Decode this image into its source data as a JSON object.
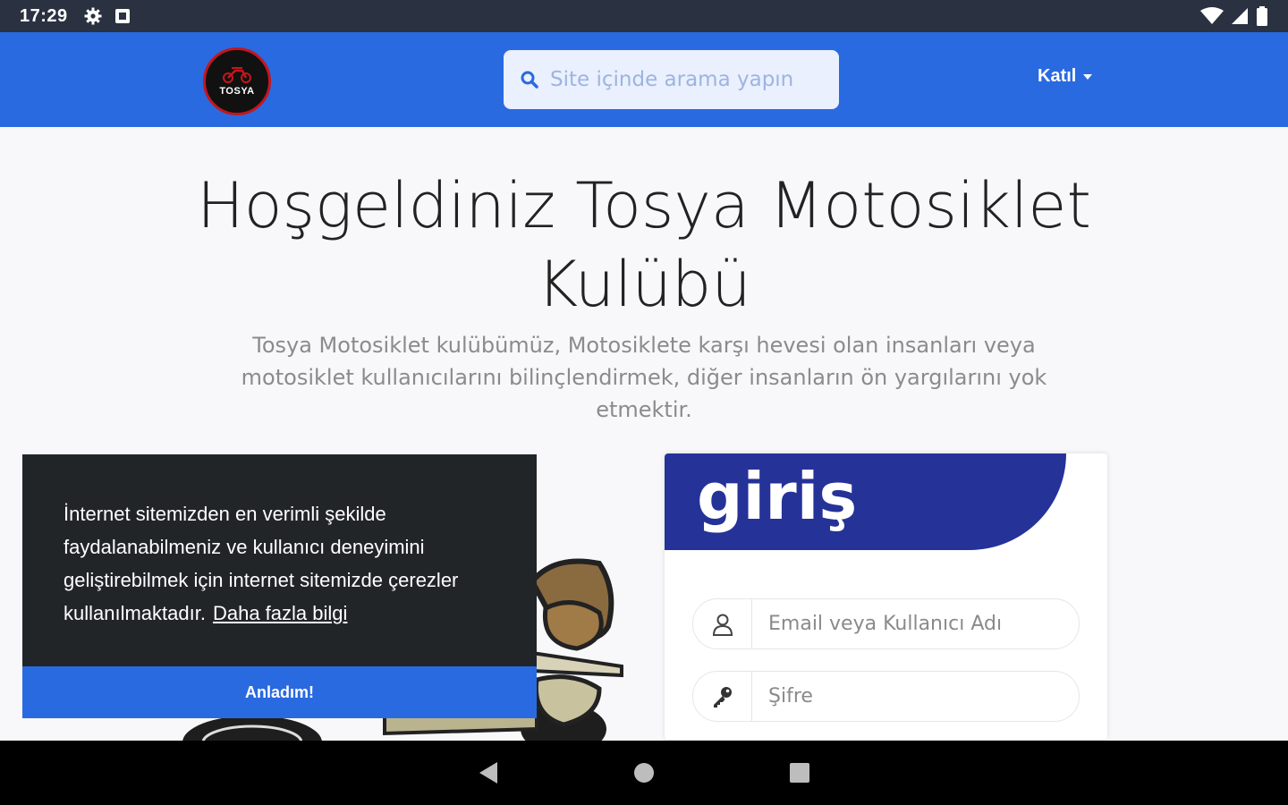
{
  "status_bar": {
    "time": "17:29",
    "icons": [
      "gear-icon",
      "app-notification-icon",
      "wifi-icon",
      "signal-icon",
      "battery-icon"
    ]
  },
  "navbar": {
    "logo_text": "TOSYA",
    "search_placeholder": "Site içinde arama yapın",
    "join_label": "Katıl"
  },
  "hero": {
    "title": "Hoşgeldiniz Tosya Motosiklet Kulübü",
    "description": "Tosya Motosiklet kulübümüz, Motosiklete karşı hevesi olan insanları veya motosiklet kullanıcılarını bilinçlendirmek, diğer insanların ön yargılarını yok etmektir."
  },
  "cookie": {
    "text": "İnternet sitemizden en verimli şekilde faydalanabilmeniz ve kullanıcı deneyimini geliştirebilmek için internet sitemizde çerezler kullanılmaktadır.",
    "link_label": "Daha fazla bilgi",
    "accept_label": "Anladım!"
  },
  "login": {
    "title": "giriş",
    "username_placeholder": "Email veya Kullanıcı Adı",
    "password_placeholder": "Şifre"
  },
  "colors": {
    "primary": "#2a6ae0",
    "banner": "#253298",
    "cookie_bg": "#222528",
    "status_bar": "#2a3140"
  }
}
